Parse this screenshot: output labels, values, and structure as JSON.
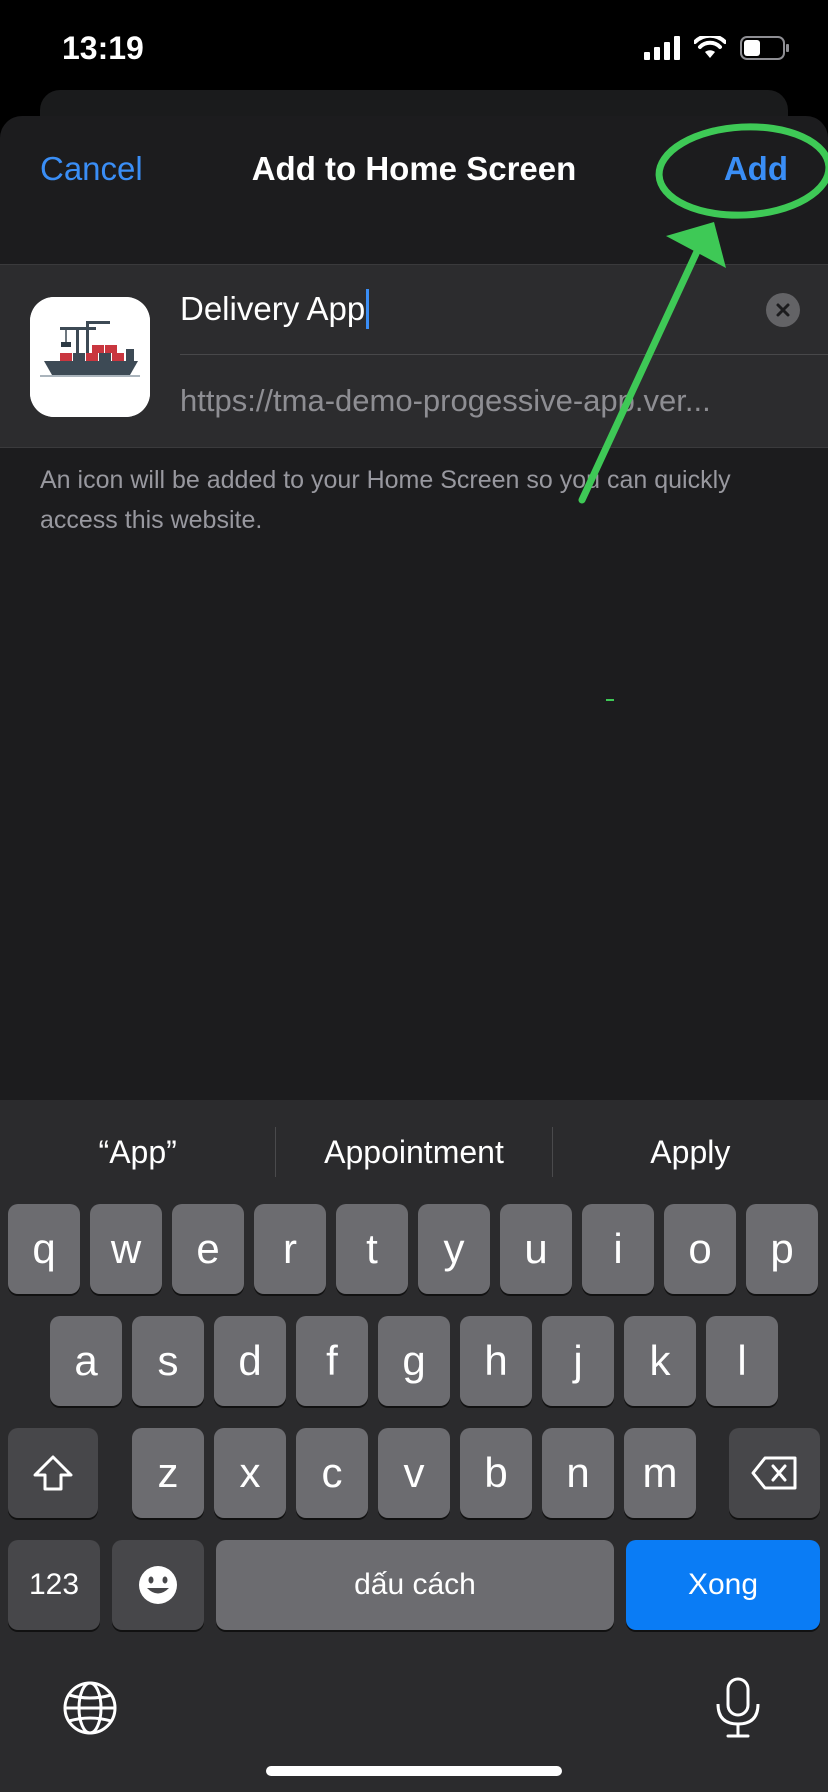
{
  "status_bar": {
    "time": "13:19"
  },
  "nav": {
    "cancel_label": "Cancel",
    "title": "Add to Home Screen",
    "add_label": "Add"
  },
  "form": {
    "name_value": "Delivery App",
    "url": "https://tma-demo-progessive-app.ver..."
  },
  "helper_text": "An icon will be added to your Home Screen so you can quickly access this website.",
  "keyboard": {
    "suggestions": [
      "“App”",
      "Appointment",
      "Apply"
    ],
    "row1": [
      "q",
      "w",
      "e",
      "r",
      "t",
      "y",
      "u",
      "i",
      "o",
      "p"
    ],
    "row2": [
      "a",
      "s",
      "d",
      "f",
      "g",
      "h",
      "j",
      "k",
      "l"
    ],
    "row3": [
      "z",
      "x",
      "c",
      "v",
      "b",
      "n",
      "m"
    ],
    "numbers_label": "123",
    "space_label": "dấu cách",
    "done_label": "Xong"
  },
  "colors": {
    "accent": "#3a8ef6",
    "annotation": "#3ec956",
    "done_key": "#0a7cf5"
  }
}
